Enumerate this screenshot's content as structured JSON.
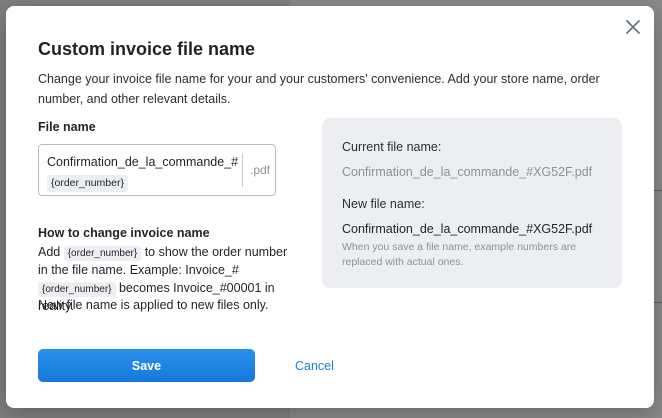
{
  "modal": {
    "title": "Custom invoice file name",
    "description": "Change your invoice file name for your and your customers' convenience. Add your store name, order number, and other relevant details.",
    "close_icon": "close-icon"
  },
  "file_name": {
    "label": "File name",
    "value_prefix": "Confirmation_de_la_commande_#",
    "value_token": "{order_number}",
    "extension": ".pdf"
  },
  "howto": {
    "title": "How to change invoice name",
    "text_1": "Add ",
    "token_1": "{order_number}",
    "text_2": " to show the order number in the file name. Example: Invoice_# ",
    "token_2": "{order_number}",
    "text_3": " becomes Invoice_#00001 in reality.",
    "note": "New file name is applied to new files only."
  },
  "preview": {
    "current_label": "Current file name:",
    "current_value": "Confirmation_de_la_commande_#XG52F.pdf",
    "new_label": "New file name:",
    "new_value": "Confirmation_de_la_commande_#XG52F.pdf",
    "hint": "When you save a file name, example numbers are replaced with actual ones."
  },
  "actions": {
    "save_label": "Save",
    "cancel_label": "Cancel"
  },
  "colors": {
    "accent": "#1a86e8",
    "link": "#1a7fd8",
    "preview_bg": "#eceef1"
  }
}
